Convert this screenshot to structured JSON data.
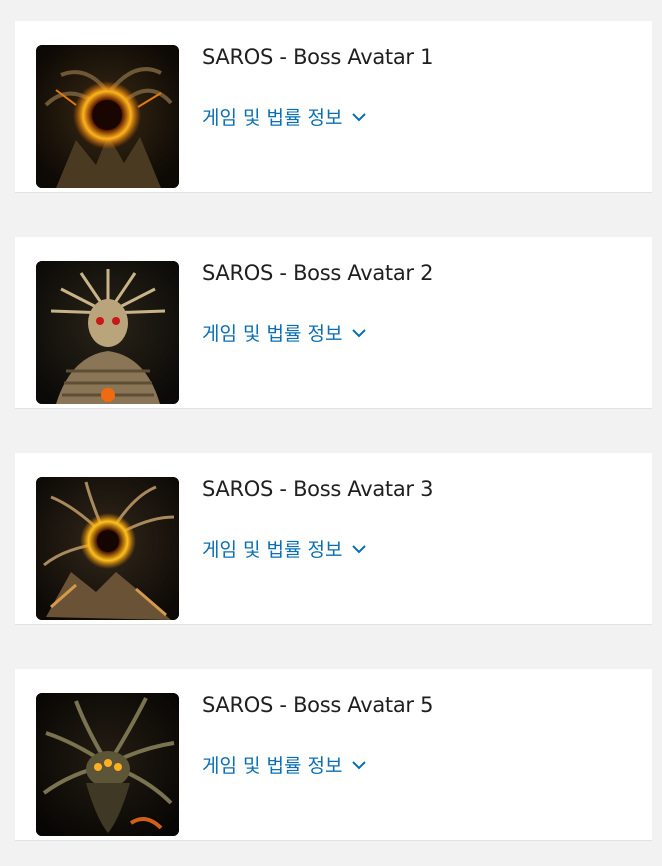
{
  "items": [
    {
      "title": "SAROS - Boss Avatar 1",
      "link_label": "게임 및 법률 정보",
      "thumb_icon": "boss-avatar-1-image",
      "accent": "#f08a16"
    },
    {
      "title": "SAROS - Boss Avatar 2",
      "link_label": "게임 및 법률 정보",
      "thumb_icon": "boss-avatar-2-image",
      "accent": "#c9b488"
    },
    {
      "title": "SAROS - Boss Avatar 3",
      "link_label": "게임 및 법률 정보",
      "thumb_icon": "boss-avatar-3-image",
      "accent": "#f0a020"
    },
    {
      "title": "SAROS - Boss Avatar 5",
      "link_label": "게임 및 법률 정보",
      "thumb_icon": "boss-avatar-5-image",
      "accent": "#e8a030"
    }
  ],
  "colors": {
    "link": "#0a6fb4",
    "title": "#1f1f1f",
    "card_bg": "#ffffff",
    "page_bg": "#f2f2f2"
  }
}
